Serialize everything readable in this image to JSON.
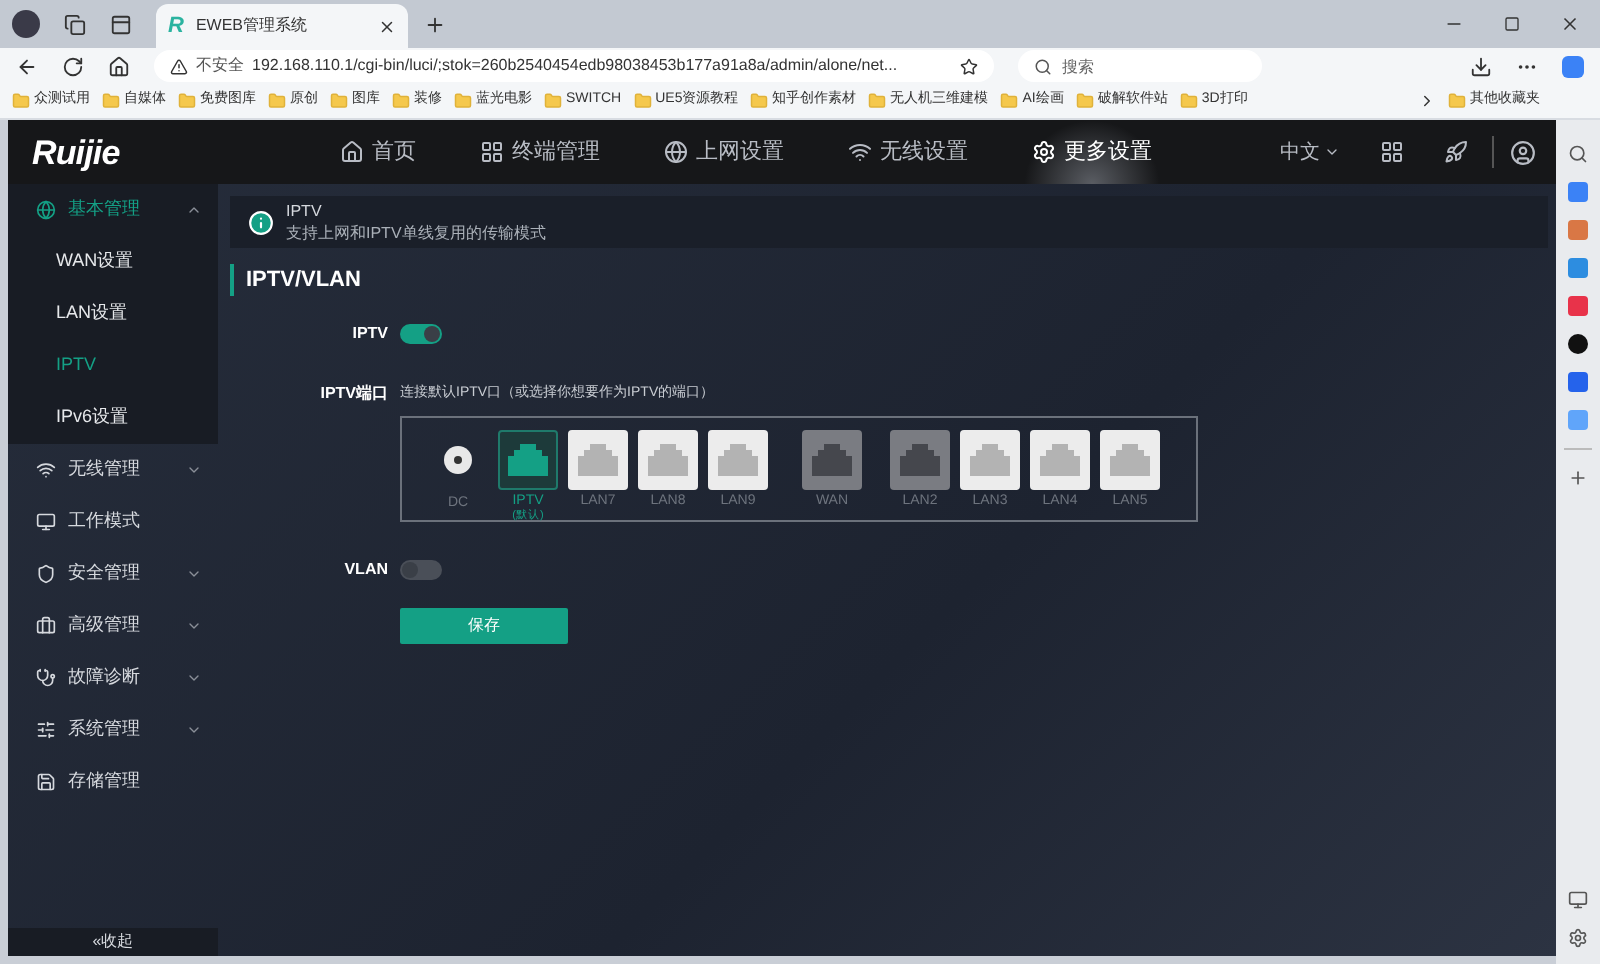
{
  "browser": {
    "tab_logo": "R",
    "tab_title": "EWEB管理系统",
    "security": "不安全",
    "url": "192.168.110.1/cgi-bin/luci/;stok=260b2540454edb98038453b177a91a8a/admin/alone/net...",
    "search_placeholder": "搜索",
    "bookmarks": [
      "众测试用",
      "自媒体",
      "免费图库",
      "原创",
      "图库",
      "装修",
      "蓝光电影",
      "SWITCH",
      "UE5资源教程",
      "知乎创作素材",
      "无人机三维建模",
      "AI绘画",
      "破解软件站",
      "3D打印"
    ],
    "more_bookmarks": "其他收藏夹"
  },
  "header": {
    "logo": "Ruijie",
    "nav": [
      {
        "label": "首页",
        "selected": false
      },
      {
        "label": "终端管理",
        "selected": false
      },
      {
        "label": "上网设置",
        "selected": false
      },
      {
        "label": "无线设置",
        "selected": false
      },
      {
        "label": "更多设置",
        "selected": true
      }
    ],
    "language": "中文"
  },
  "sidebar": {
    "items": [
      {
        "kind": "group",
        "label": "基本管理",
        "expanded": true,
        "children": [
          {
            "label": "WAN设置",
            "selected": false
          },
          {
            "label": "LAN设置",
            "selected": false
          },
          {
            "label": "IPTV",
            "selected": true
          },
          {
            "label": "IPv6设置",
            "selected": false
          }
        ]
      },
      {
        "kind": "group",
        "label": "无线管理",
        "expanded": false
      },
      {
        "kind": "link",
        "label": "工作模式"
      },
      {
        "kind": "group",
        "label": "安全管理",
        "expanded": false
      },
      {
        "kind": "group",
        "label": "高级管理",
        "expanded": false
      },
      {
        "kind": "group",
        "label": "故障诊断",
        "expanded": false
      },
      {
        "kind": "group",
        "label": "系统管理",
        "expanded": false
      },
      {
        "kind": "link",
        "label": "存储管理"
      }
    ],
    "collapse": "«收起"
  },
  "info": {
    "title": "IPTV",
    "text": "支持上网和IPTV单线复用的传输模式"
  },
  "section_title": "IPTV/VLAN",
  "form": {
    "iptv_label": "IPTV",
    "iptv_on": true,
    "port_label": "IPTV端口",
    "port_hint": "连接默认IPTV口（或选择你想要作为IPTV的端口）",
    "ports": [
      {
        "kind": "dc",
        "label": "DC"
      },
      {
        "kind": "port",
        "label": "IPTV",
        "sublabel": "(默认)",
        "selected": true,
        "disabled": false
      },
      {
        "kind": "port",
        "label": "LAN7",
        "selected": false,
        "disabled": false
      },
      {
        "kind": "port",
        "label": "LAN8",
        "selected": false,
        "disabled": false
      },
      {
        "kind": "port",
        "label": "LAN9",
        "selected": false,
        "disabled": false
      },
      {
        "kind": "port",
        "label": "WAN",
        "selected": false,
        "disabled": true
      },
      {
        "kind": "port",
        "label": "LAN2",
        "selected": false,
        "disabled": true
      },
      {
        "kind": "port",
        "label": "LAN3",
        "selected": false,
        "disabled": false
      },
      {
        "kind": "port",
        "label": "LAN4",
        "selected": false,
        "disabled": false
      },
      {
        "kind": "port",
        "label": "LAN5",
        "selected": false,
        "disabled": false
      }
    ],
    "vlan_label": "VLAN",
    "vlan_on": false,
    "save": "保存"
  }
}
